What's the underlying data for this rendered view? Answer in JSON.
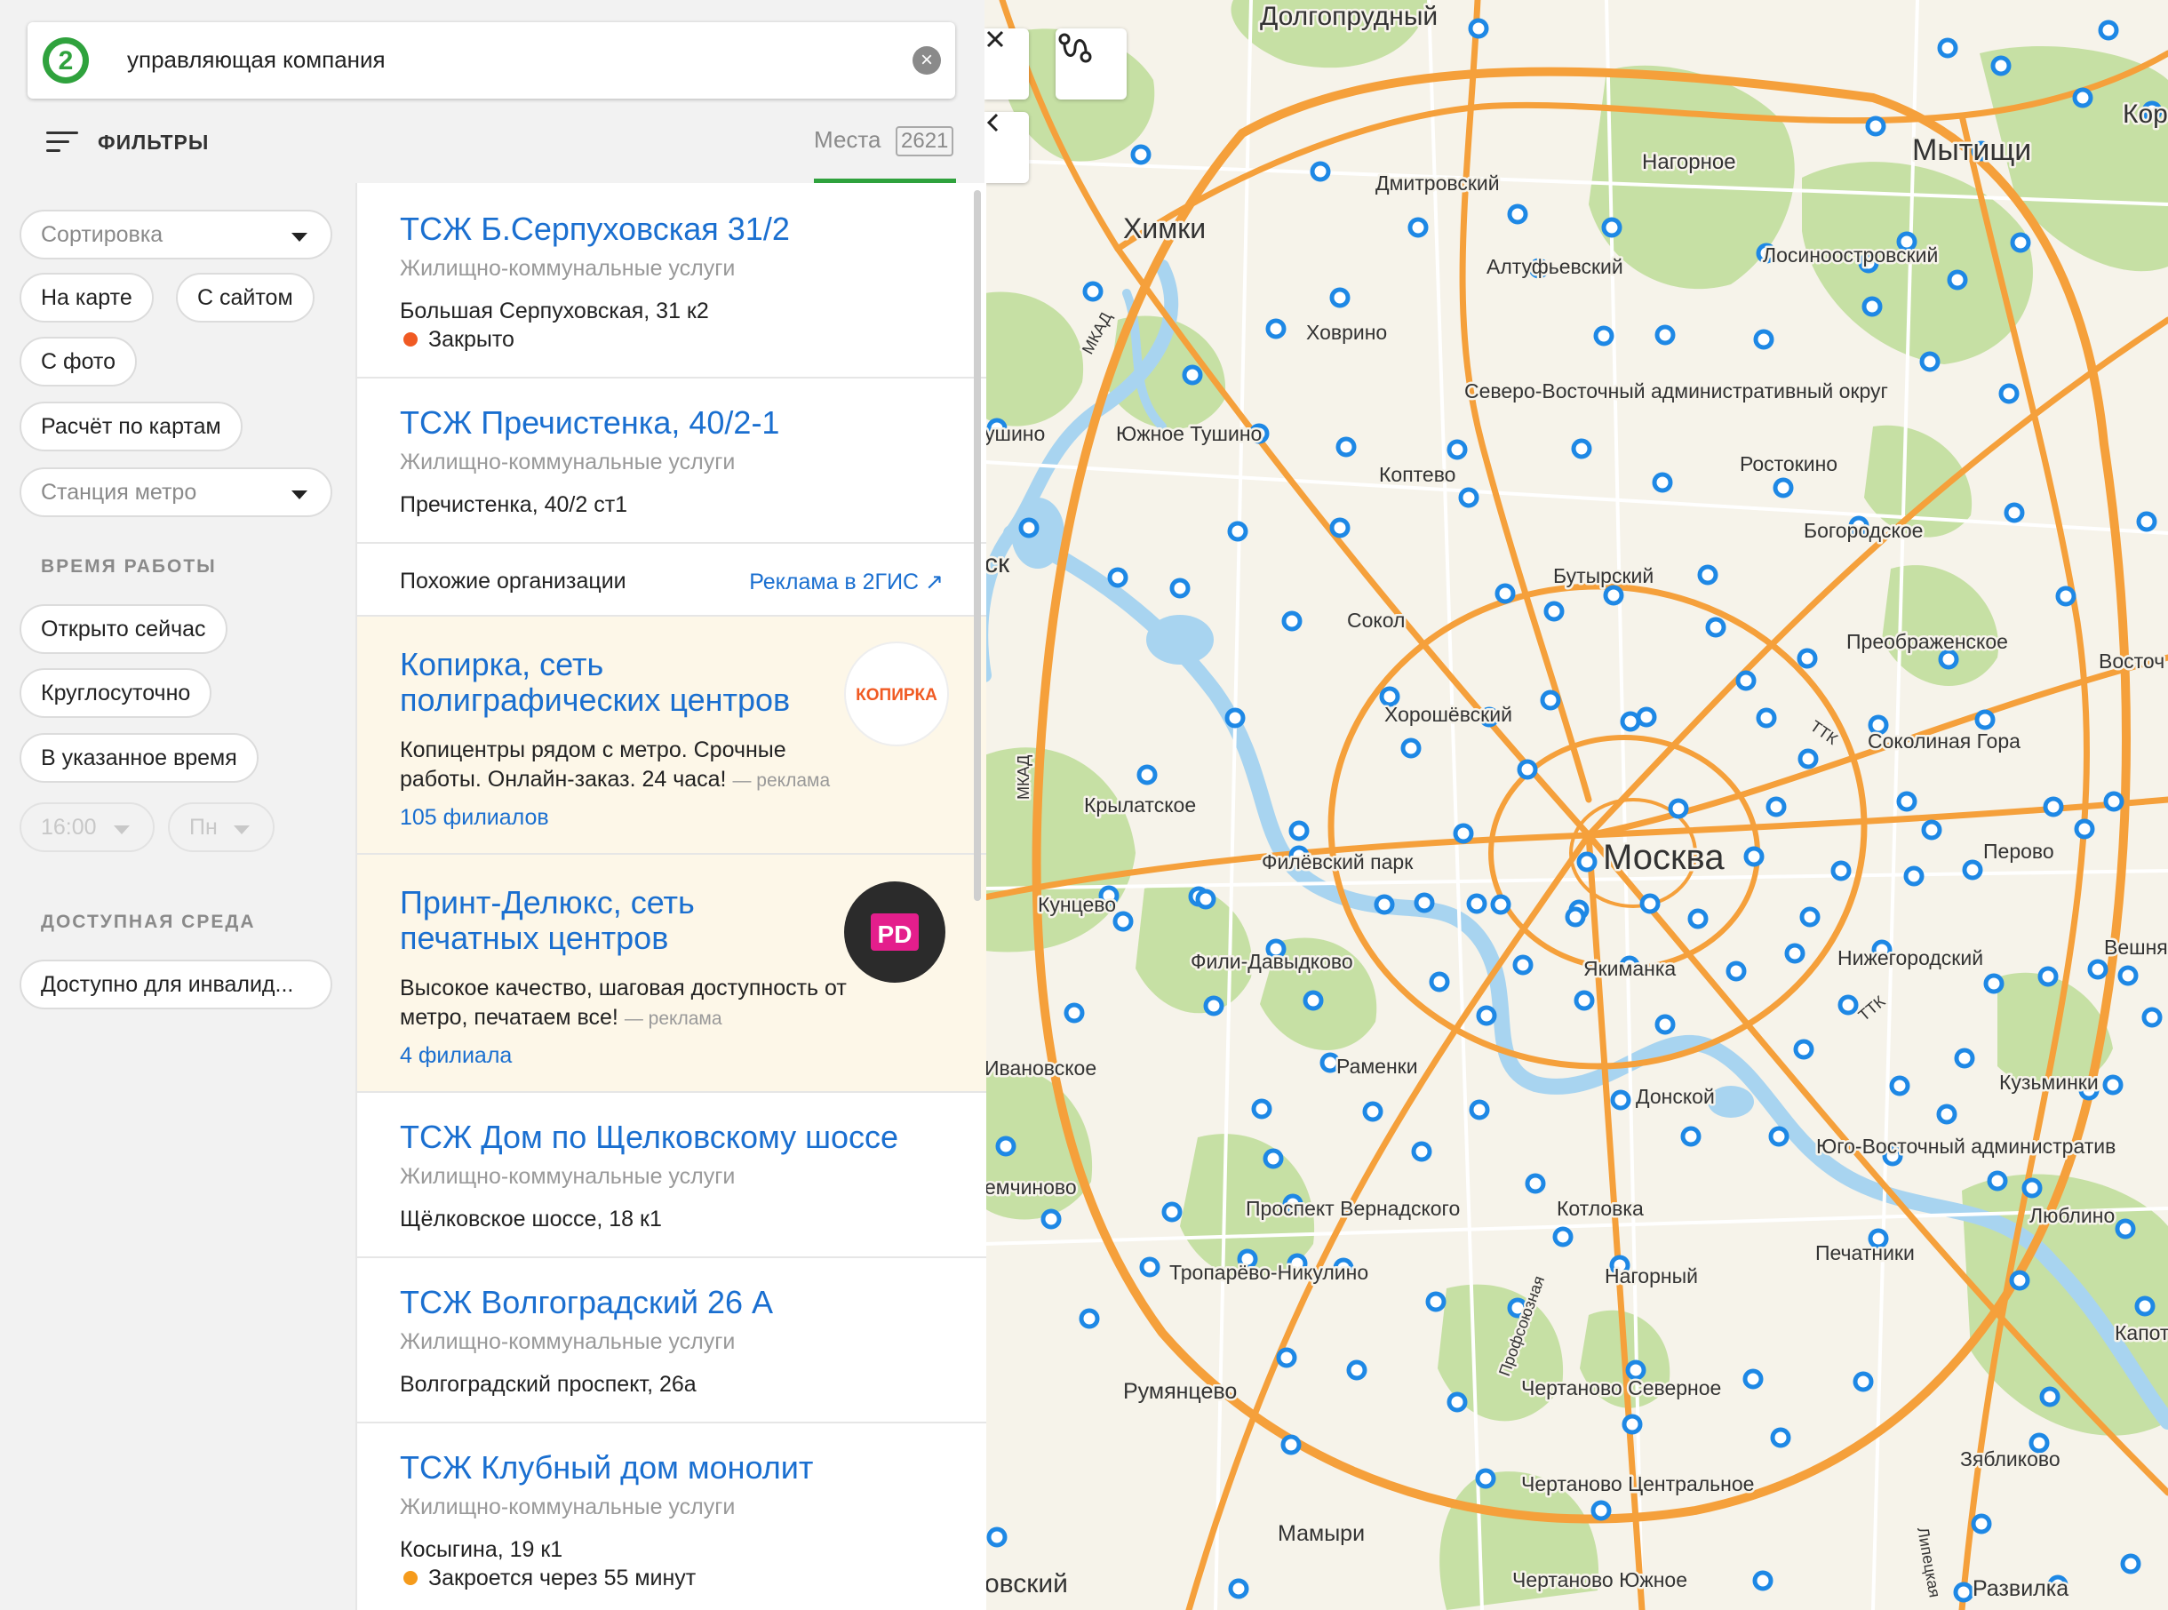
{
  "search": {
    "query": "управляющая компания",
    "clear_icon": "close-circle-icon",
    "logo": "2gis-logo"
  },
  "toolbar": {
    "filters_label": "ФИЛЬТРЫ",
    "places_label": "Места",
    "places_count": "2621"
  },
  "filters": {
    "sort": "Сортировка",
    "on_map": "На карте",
    "with_site": "С сайтом",
    "with_photo": "С фото",
    "card_payment": "Расчёт по картам",
    "metro": "Станция метро",
    "hours_title": "ВРЕМЯ РАБОТЫ",
    "open_now": "Открыто сейчас",
    "around_clock": "Круглосуточно",
    "at_time": "В указанное время",
    "time_value": "16:00",
    "day_value": "Пн",
    "access_title": "ДОСТУПНАЯ СРЕДА",
    "accessible": "Доступно для инвалид..."
  },
  "results": [
    {
      "title": "ТСЖ Б.Серпуховская 31/2",
      "category": "Жилищно-коммунальные услуги",
      "address": "Большая Серпуховская, 31 к2",
      "status": "Закрыто",
      "status_color": "#f05a23"
    },
    {
      "title": "ТСЖ Пречистенка, 40/2-1",
      "category": "Жилищно-коммунальные услуги",
      "address": "Пречистенка, 40/2 ст1"
    },
    {
      "title": "ТСЖ Дом по Щелковскому шоссе",
      "category": "Жилищно-коммунальные услуги",
      "address": "Щёлковское шоссе, 18 к1"
    },
    {
      "title": "ТСЖ Волгоградский 26 А",
      "category": "Жилищно-коммунальные услуги",
      "address": "Волгоградский проспект, 26а"
    },
    {
      "title": "ТСЖ Клубный дом монолит",
      "category": "Жилищно-коммунальные услуги",
      "address": "Косыгина, 19 к1",
      "status": "Закроется через 55 минут",
      "status_color": "#f59b1c"
    }
  ],
  "similar": {
    "label": "Похожие организации",
    "ad_link": "Реклама в 2ГИС ↗"
  },
  "ads": [
    {
      "title_line1": "Копирка, сеть",
      "title_line2": "полиграфических центров",
      "desc": "Копицентры рядом с метро. Срочные работы. Онлайн-заказ. 24 часа!",
      "ad_tag": "— реклама",
      "branches": "105 филиалов",
      "logo_text": "КОПИРКА"
    },
    {
      "title_line1": "Принт-Делюкс, сеть",
      "title_line2": "печатных центров",
      "desc": "Высокое качество, шаговая доступность от метро, печатаем все!",
      "ad_tag": "— реклама",
      "branches": "4 филиала",
      "logo_text": "PD"
    }
  ],
  "map": {
    "close_icon": "close-icon",
    "route_icon": "route-icon",
    "collapse_icon": "chevron-left-icon",
    "labels": {
      "dolgoprudny": "Долгопрудный",
      "mytishchi": "Мытищи",
      "kor": "Кор",
      "khimki": "Химки",
      "nagornoe": "Нагорное",
      "dmitrovsky": "Дмитровский",
      "altufievsky": "Алтуфьевский",
      "losinoostrovsky": "Лосиноостровский",
      "khovrino": "Ховрино",
      "svao": "Северо-Восточный административный округ",
      "yuzhnoe_tushino": "Южное Тушино",
      "tushino_left": "ушино",
      "koptevo": "Коптево",
      "rostokino": "Ростокино",
      "bogorodskoe": "Богородское",
      "butyrsky": "Бутырский",
      "sk": "ск",
      "sokol": "Сокол",
      "preobrazhenskoe": "Преображенское",
      "vostochny": "Восточ",
      "khoroshevsky": "Хорошёвский",
      "sokolinaya": "Соколиная Гора",
      "krylatskoe": "Крылатское",
      "moskva": "Москва",
      "filevsky": "Филёвский парк",
      "perovo": "Перово",
      "kuntsevo": "Кунцево",
      "fili": "Фили-Давыдково",
      "yakimanka": "Якиманка",
      "nizhegorodsky": "Нижегородский",
      "veshnya": "Вешня",
      "ivanovskoe": "Ивановское",
      "ramenki": "Раменки",
      "donskoy": "Донской",
      "kuzminki": "Кузьминки",
      "yuvao": "Юго-Восточный административ",
      "ochakovo": "емчиново",
      "vernadskogo": "Проспект Вернадского",
      "kotlovka": "Котловка",
      "lyublino": "Люблино",
      "troparevo": "Тропарёво-Никулино",
      "nagorny": "Нагорный",
      "pechatniki": "Печатники",
      "kapot": "Капот",
      "rumyantsevo": "Румянцево",
      "chertanovo_n": "Чертаново Северное",
      "zyablikovo": "Зябликово",
      "chertanovo_c": "Чертаново Центральное",
      "mamyri": "Мамыри",
      "ovsky": "овский",
      "chertanovo_s": "Чертаново Южное",
      "razvilka": "Развилка",
      "mkad": "МКАД",
      "ttk": "ТТК",
      "profsoyuznaya": "Профсоюзная",
      "lipetskaya": "Липецкая"
    }
  },
  "colors": {
    "link": "#1a6fd0",
    "accent_green": "#2fa23d",
    "map_marker": "#1e88e5",
    "road": "#f5a03b",
    "park": "#c6e0a4",
    "water": "#a8d4f0"
  }
}
